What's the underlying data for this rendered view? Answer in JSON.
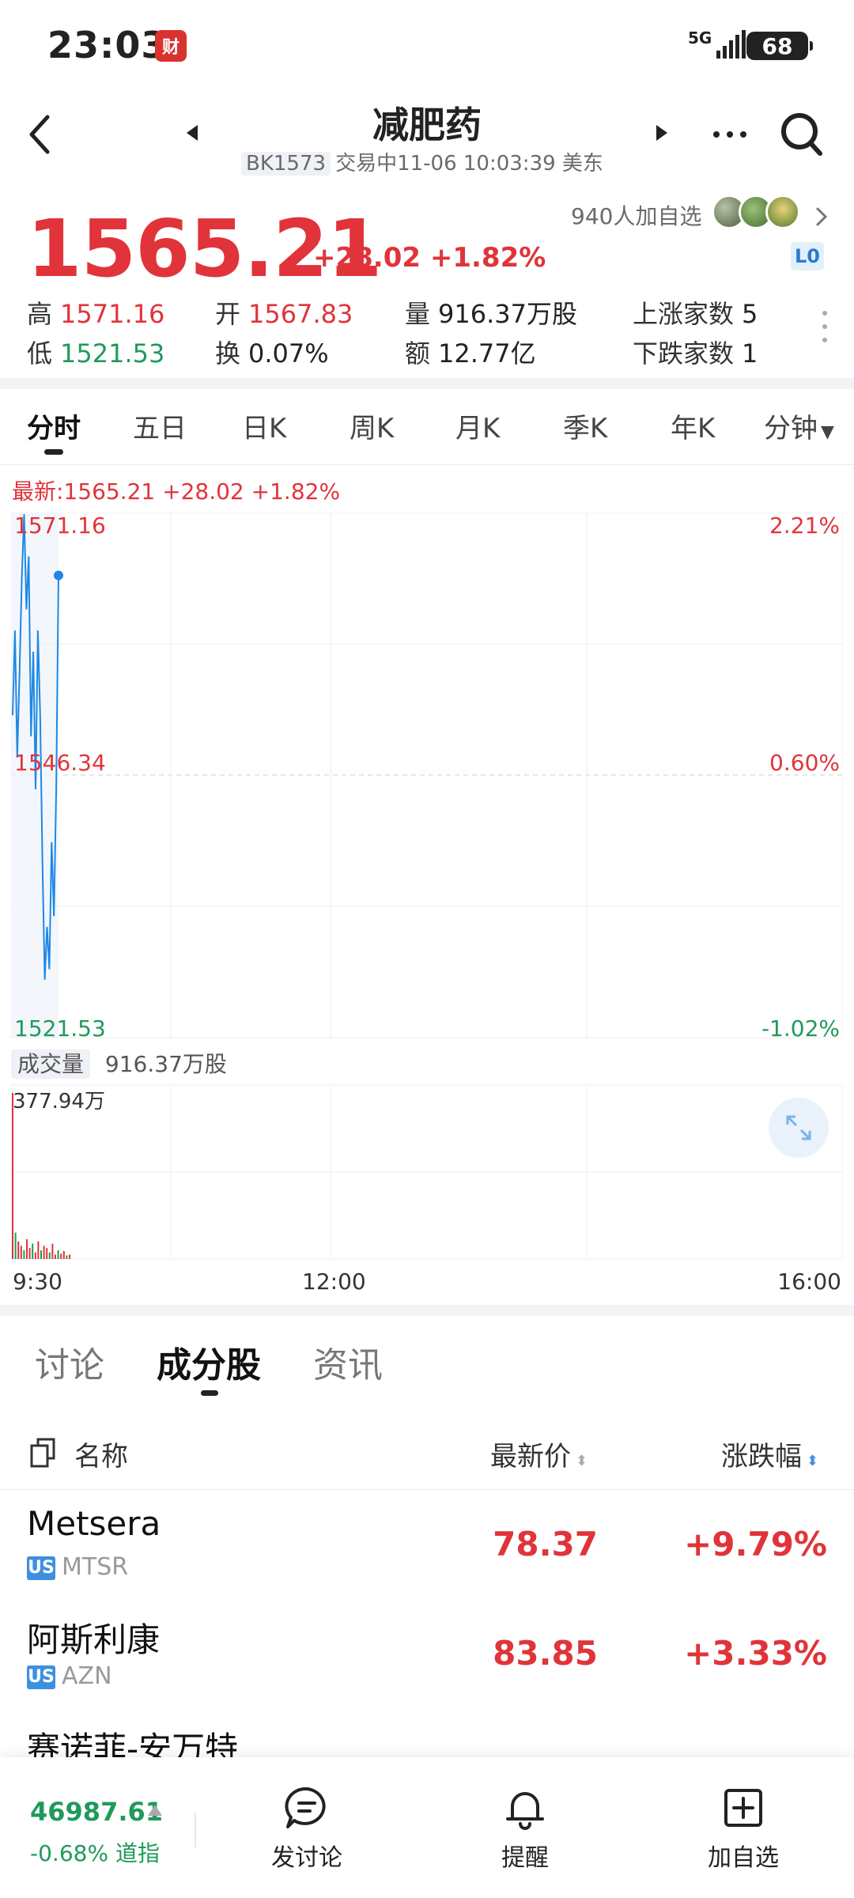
{
  "status_bar": {
    "time": "23:03",
    "app_badge": "财",
    "network": "5G",
    "battery": "68"
  },
  "header": {
    "title": "减肥药",
    "code": "BK1573",
    "status": "交易中11-06 10:03:39 美东"
  },
  "quote": {
    "price": "1565.21",
    "change": "+28.02 +1.82%",
    "followers": "940人加自选",
    "level": "L0",
    "stats": {
      "high_label": "高",
      "high": "1571.16",
      "open_label": "开",
      "open": "1567.83",
      "volume_label": "量",
      "volume": "916.37万股",
      "up_label": "上涨家数",
      "up": "5",
      "low_label": "低",
      "low": "1521.53",
      "turnover_label": "换",
      "turnover": "0.07%",
      "amount_label": "额",
      "amount": "12.77亿",
      "down_label": "下跌家数",
      "down": "1"
    }
  },
  "period_tabs": [
    "分时",
    "五日",
    "日K",
    "周K",
    "月K",
    "季K",
    "年K",
    "分钟"
  ],
  "chart": {
    "latest": "最新:1565.21  +28.02  +1.82%",
    "y_high": "1571.16",
    "y_mid": "1546.34",
    "y_low": "1521.53",
    "pct_high": "2.21%",
    "pct_mid": "0.60%",
    "pct_low": "-1.02%",
    "volume_tag": "成交量",
    "volume_total": "916.37万股",
    "volume_max": "377.94万",
    "x_start": "9:30",
    "x_mid": "12:00",
    "x_end": "16:00"
  },
  "chart_data": {
    "type": "line",
    "y_range": [
      1521.53,
      1571.16
    ],
    "x_range": [
      "9:30",
      "16:00"
    ],
    "series": [
      {
        "values": [
          1552,
          1560,
          1548,
          1556,
          1565,
          1571,
          1562,
          1567,
          1550,
          1558,
          1545,
          1560,
          1552,
          1538,
          1527,
          1532,
          1528,
          1540,
          1533,
          1545,
          1565.21
        ]
      }
    ],
    "volume_series": [
      377.94,
      60,
      40,
      30,
      20,
      45,
      25,
      35,
      15,
      40,
      20,
      30,
      25,
      15,
      35,
      10,
      20,
      12,
      18,
      8,
      10
    ]
  },
  "bottom_tabs": [
    "讨论",
    "成分股",
    "资讯"
  ],
  "list": {
    "header": {
      "name": "名称",
      "price": "最新价",
      "change": "涨跌幅"
    },
    "rows": [
      {
        "name": "Metsera",
        "market": "US",
        "ticker": "MTSR",
        "price": "78.37",
        "change": "+9.79%"
      },
      {
        "name": "阿斯利康",
        "market": "US",
        "ticker": "AZN",
        "price": "83.85",
        "change": "+3.33%"
      },
      {
        "name": "赛诺菲-安万特",
        "market": "",
        "ticker": "",
        "price": "",
        "change": ""
      }
    ]
  },
  "bottom_bar": {
    "index_value": "46987.61",
    "index_change": "-0.68%",
    "index_name": "道指",
    "discuss": "发讨论",
    "remind": "提醒",
    "add_watch": "加自选"
  },
  "colors": {
    "up": "#e0343a",
    "down": "#1f9a5a",
    "line": "#1e88e5"
  }
}
